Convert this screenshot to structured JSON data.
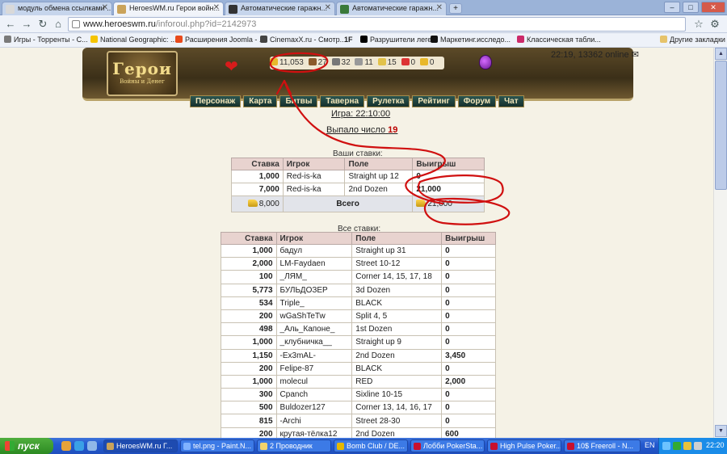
{
  "tabs": [
    {
      "title": "модуль обмена ссылками ...",
      "color": "#d9d9d9"
    },
    {
      "title": "HeroesWM.ru Герои войн...",
      "color": "#caa35a"
    },
    {
      "title": "Автоматические гаражн...",
      "color": "#333333"
    },
    {
      "title": "Автоматические гаражн...",
      "color": "#3a7a3a"
    }
  ],
  "window_buttons": {
    "minimize": "–",
    "maximize": "□",
    "close": "✕"
  },
  "url": {
    "host": "www.heroeswm.ru",
    "path": "/inforoul.php?id=2142973"
  },
  "bookmarks": [
    {
      "label": "Игры - Торренты - С...",
      "color": "#7a7a7a"
    },
    {
      "label": "National Geographic: ...",
      "color": "#f5c400"
    },
    {
      "label": "Расширения Joomla - ...",
      "color": "#e84a1c"
    },
    {
      "label": "CinemaxX.ru - Смотр...",
      "color": "#444444"
    },
    {
      "label": "1F",
      "color": "#222222"
    },
    {
      "label": "Разрушители леге...",
      "color": "#000000"
    },
    {
      "label": "Маркетинг.исследо...",
      "color": "#111111"
    },
    {
      "label": "Классическая табли...",
      "color": "#cc2a6a"
    },
    {
      "label": "Другие закладки",
      "color": "#e6c36a"
    }
  ],
  "game": {
    "logo_title": "Герои",
    "logo_subtitle": "Войны и Денег",
    "resources": {
      "gold": "11,053",
      "wood": "27",
      "ore": "32",
      "mercury": "11",
      "sulfur": "15",
      "crystals": "0",
      "gems": "0"
    },
    "menu": [
      "Персонаж",
      "Карта",
      "Битвы",
      "Таверна",
      "Рулетка",
      "Рейтинг",
      "Форум",
      "Чат"
    ],
    "status_online": "22:19, 13362 online"
  },
  "page": {
    "game_time_label": "Игра: 22:10:00",
    "drop_label": "Выпало число",
    "drop_number": "19",
    "my_bets_caption": "Ваши ставки:",
    "all_bets_caption": "Все ставки:",
    "columns": {
      "stake": "Ставка",
      "player": "Игрок",
      "field": "Поле",
      "win": "Выигрыш"
    },
    "total_label": "Всего"
  },
  "my_bets": [
    {
      "stake": "1,000",
      "player": "Red-is-ka",
      "field": "Straight up 12",
      "win": "0"
    },
    {
      "stake": "7,000",
      "player": "Red-is-ka",
      "field": "2nd Dozen",
      "win": "21,000"
    }
  ],
  "my_total": {
    "stake": "8,000",
    "win": "21,000"
  },
  "all_bets": [
    {
      "stake": "1,000",
      "player": "бадул",
      "field": "Straight up 31",
      "win": "0"
    },
    {
      "stake": "2,000",
      "player": "LM-Faydaen",
      "field": "Street 10-12",
      "win": "0"
    },
    {
      "stake": "100",
      "player": "_ЛЯМ_",
      "field": "Corner 14, 15, 17, 18",
      "win": "0"
    },
    {
      "stake": "5,773",
      "player": "БУЛЬДОЗЕР",
      "field": "3d Dozen",
      "win": "0"
    },
    {
      "stake": "534",
      "player": "Triple_",
      "field": "BLACK",
      "win": "0"
    },
    {
      "stake": "200",
      "player": "wGaShTeTw",
      "field": "Split 4, 5",
      "win": "0"
    },
    {
      "stake": "498",
      "player": "_Аль_Капоне_",
      "field": "1st Dozen",
      "win": "0"
    },
    {
      "stake": "1,000",
      "player": "_клубничка__",
      "field": "Straight up 9",
      "win": "0"
    },
    {
      "stake": "1,150",
      "player": "-Ex3mAL-",
      "field": "2nd Dozen",
      "win": "3,450"
    },
    {
      "stake": "200",
      "player": "Felipe-87",
      "field": "BLACK",
      "win": "0"
    },
    {
      "stake": "1,000",
      "player": "molecul",
      "field": "RED",
      "win": "2,000"
    },
    {
      "stake": "300",
      "player": "Cpanch",
      "field": "Sixline 10-15",
      "win": "0"
    },
    {
      "stake": "500",
      "player": "Buldozer127",
      "field": "Corner 13, 14, 16, 17",
      "win": "0"
    },
    {
      "stake": "815",
      "player": "-Archi",
      "field": "Street 28-30",
      "win": "0"
    },
    {
      "stake": "200",
      "player": "крутая-тёлка12",
      "field": "2nd Dozen",
      "win": "600"
    }
  ],
  "taskbar": {
    "start_label": "пуск",
    "tasks": [
      {
        "label": "HeroesWM.ru Г...",
        "color": "#caa35a"
      },
      {
        "label": "tel.png - Paint.N...",
        "color": "#7fb2ff"
      },
      {
        "label": "2 Проводник",
        "color": "#f3d36b"
      },
      {
        "label": "Bomb Club / DE...",
        "color": "#e6b800"
      },
      {
        "label": "Лобби PokerSta...",
        "color": "#c8102e"
      },
      {
        "label": "High Pulse Poker...",
        "color": "#c8102e"
      },
      {
        "label": "10$ Freeroll - N...",
        "color": "#c8102e"
      }
    ],
    "language": "EN",
    "clock": "22:20"
  },
  "colors": {
    "annotation": "#d01010",
    "accent_gold": "#c79a16"
  }
}
